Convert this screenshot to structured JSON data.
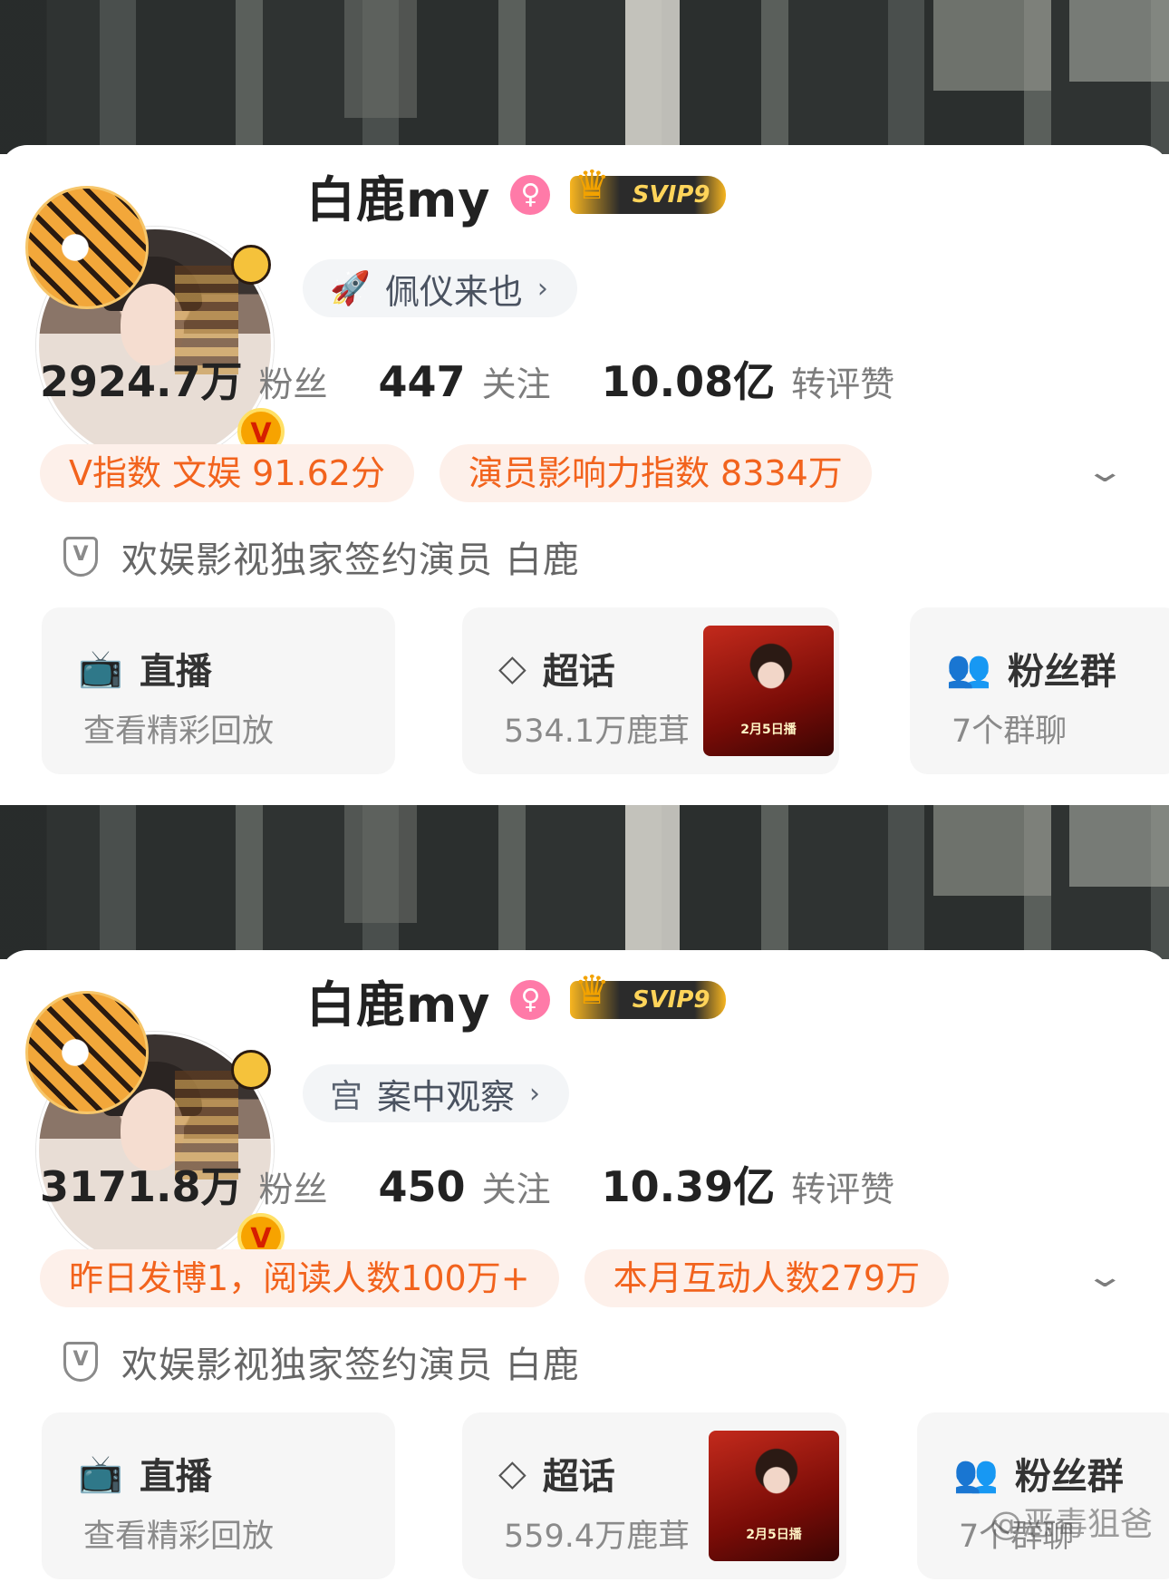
{
  "panels": [
    {
      "name": "白鹿my",
      "tag_label": "佩仪来也",
      "tag_icon": "rocket-icon",
      "stats": [
        {
          "value": "2924.7万",
          "label": "粉丝"
        },
        {
          "value": "447",
          "label": "关注"
        },
        {
          "value": "10.08亿",
          "label": "转评赞"
        }
      ],
      "chips": [
        "V指数 文娱 91.62分",
        "演员影响力指数 8334万"
      ],
      "verification": "欢娱影视独家签约演员 白鹿",
      "tiles": {
        "live": {
          "title": "直播",
          "sub": "查看精彩回放"
        },
        "topic": {
          "title": "超话",
          "sub": "534.1万鹿茸"
        },
        "fans": {
          "title": "粉丝群",
          "sub": "7个群聊"
        }
      },
      "vip": "SVIP9"
    },
    {
      "name": "白鹿my",
      "tag_label": "案中观察",
      "tag_icon": "palace-icon",
      "stats": [
        {
          "value": "3171.8万",
          "label": "粉丝"
        },
        {
          "value": "450",
          "label": "关注"
        },
        {
          "value": "10.39亿",
          "label": "转评赞"
        }
      ],
      "chips": [
        "昨日发博1，阅读人数100万+",
        "本月互动人数279万"
      ],
      "verification": "欢娱影视独家签约演员 白鹿",
      "tiles": {
        "live": {
          "title": "直播",
          "sub": "查看精彩回放"
        },
        "topic": {
          "title": "超话",
          "sub": "559.4万鹿茸"
        },
        "fans": {
          "title": "粉丝群",
          "sub": "7个群聊"
        }
      },
      "vip": "SVIP9"
    }
  ],
  "poster_caption": "2月5日播",
  "watermark": "@恶毒狙爸",
  "colors": {
    "accent_orange": "#f2631d",
    "chip_bg": "#fdf0ea",
    "tile_bg": "#f6f6f6"
  }
}
